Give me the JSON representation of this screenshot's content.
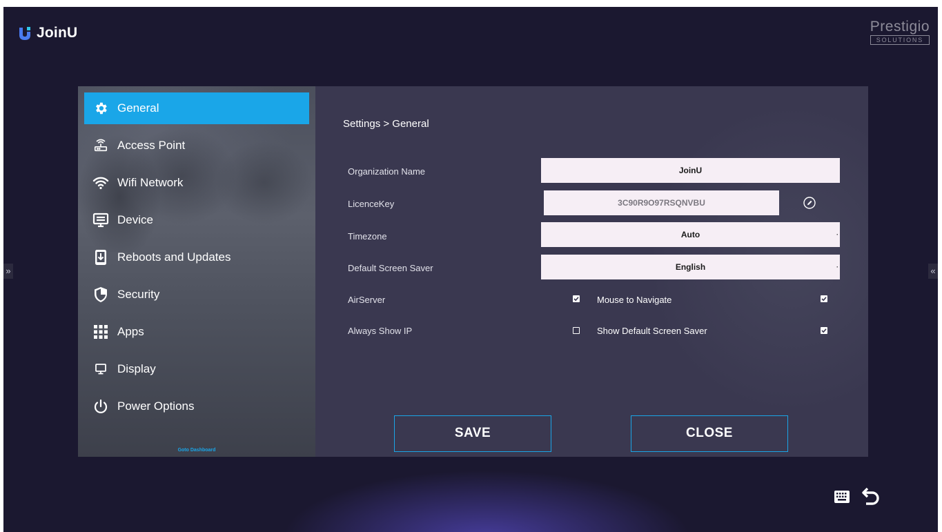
{
  "app": {
    "name": "JoinU",
    "brand": "Prestigio",
    "brand_sub": "SOLUTIONS"
  },
  "edges": {
    "left": "»",
    "right": "«"
  },
  "sidebar": {
    "items": [
      {
        "label": "General",
        "icon": "gear-icon",
        "active": true
      },
      {
        "label": "Access Point",
        "icon": "router-icon"
      },
      {
        "label": "Wifi Network",
        "icon": "wifi-icon"
      },
      {
        "label": "Device",
        "icon": "monitor-icon"
      },
      {
        "label": "Reboots and Updates",
        "icon": "download-icon"
      },
      {
        "label": "Security",
        "icon": "shield-icon"
      },
      {
        "label": "Apps",
        "icon": "grid-icon"
      },
      {
        "label": "Display",
        "icon": "display-icon"
      },
      {
        "label": "Power Options",
        "icon": "power-icon"
      }
    ],
    "goto_dashboard": "Goto Dashboard"
  },
  "content": {
    "breadcrumb": "Settings > General",
    "fields": {
      "organization_name": {
        "label": "Organization Name",
        "value": "JoinU"
      },
      "licence_key": {
        "label": "LicenceKey",
        "value": "3C90R9O97RSQNVBU"
      },
      "timezone": {
        "label": "Timezone",
        "value": "Auto"
      },
      "screen_saver": {
        "label": "Default Screen Saver",
        "value": "English"
      }
    },
    "options": {
      "airserver": {
        "label": "AirServer",
        "checked": true
      },
      "mouse_navigate": {
        "label": "Mouse to Navigate",
        "checked": true
      },
      "always_show_ip": {
        "label": "Always Show IP",
        "checked": false
      },
      "show_screen_saver": {
        "label": "Show Default Screen Saver",
        "checked": true
      }
    },
    "buttons": {
      "save": "SAVE",
      "close": "CLOSE"
    }
  },
  "colors": {
    "accent": "#1aa6e8",
    "background": "#1b1830",
    "panel": "#3a3850",
    "field": "#f6eef5"
  }
}
